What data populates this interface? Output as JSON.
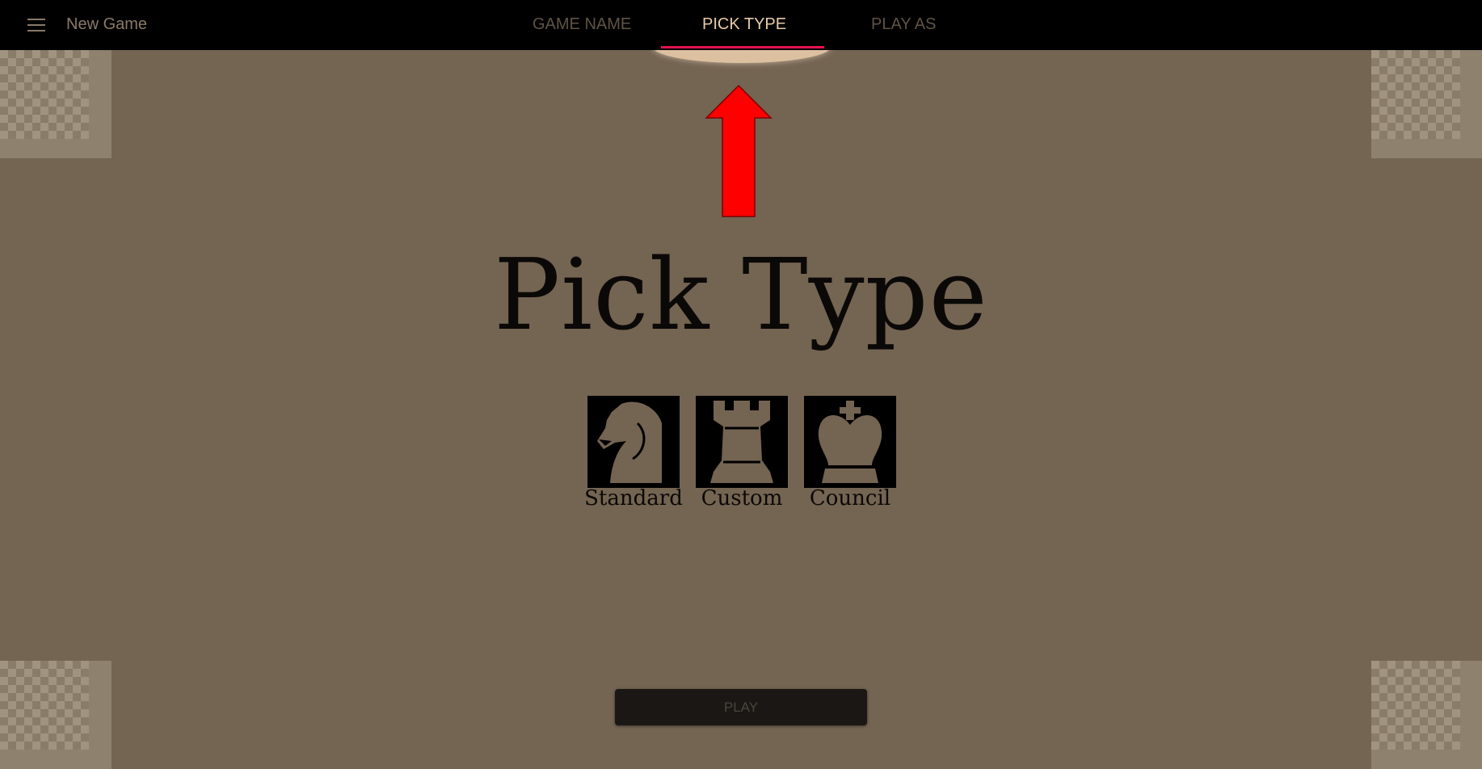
{
  "header": {
    "title": "New Game",
    "menu_icon": "hamburger-menu-icon",
    "tabs": [
      {
        "label": "GAME NAME",
        "active": false
      },
      {
        "label": "PICK TYPE",
        "active": true
      },
      {
        "label": "PLAY AS",
        "active": false
      }
    ]
  },
  "main": {
    "heading": "Pick Type",
    "types": [
      {
        "label": "Standard",
        "icon": "knight-icon"
      },
      {
        "label": "Custom",
        "icon": "rook-icon"
      },
      {
        "label": "Council",
        "icon": "king-icon"
      }
    ],
    "play_label": "PLAY"
  },
  "annotation": {
    "icon": "red-arrow-up-icon",
    "color": "#ff0000"
  },
  "colors": {
    "background": "#746452",
    "topbar": "#000000",
    "active_tab": "#e8cbaa",
    "tab_indicator": "#e3134f"
  }
}
